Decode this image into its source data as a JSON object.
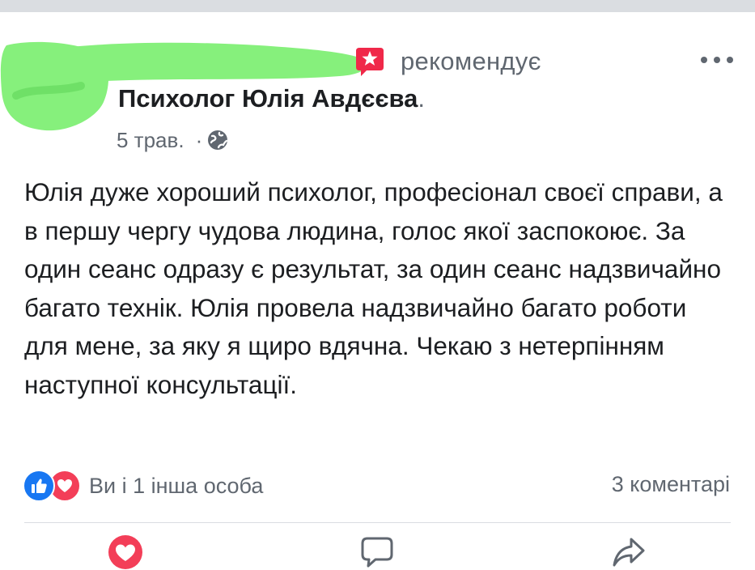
{
  "post": {
    "recommends_text": "рекомендує",
    "page_name": "Психолог Юлія Авдєєва",
    "page_name_suffix": ".",
    "date": "5 трав.",
    "date_separator": "·",
    "privacy_icon": "globe-icon",
    "body": "Юлія дуже хороший психолог, професіонал своєї справи, а в першу чергу чудова людина, голос якої заспокоює. За один сеанс одразу є результат, за один сеанс надзвичайно багато технік. Юлія провела надзвичайно багато роботи для мене, за яку я щиро вдячна. Чекаю з нетерпінням наступної консультації."
  },
  "reactions": {
    "icons": [
      "like-icon",
      "love-icon"
    ],
    "text": "Ви і 1 інша особа",
    "comments": "3 коментарі"
  },
  "actions": {
    "icons": [
      "love-icon",
      "comment-icon",
      "share-icon"
    ]
  },
  "colors": {
    "redaction_green": "#86f07c",
    "recommend_red": "#f02849",
    "like_blue": "#1877f2",
    "love_red": "#f33e58",
    "secondary_text": "#606770"
  }
}
